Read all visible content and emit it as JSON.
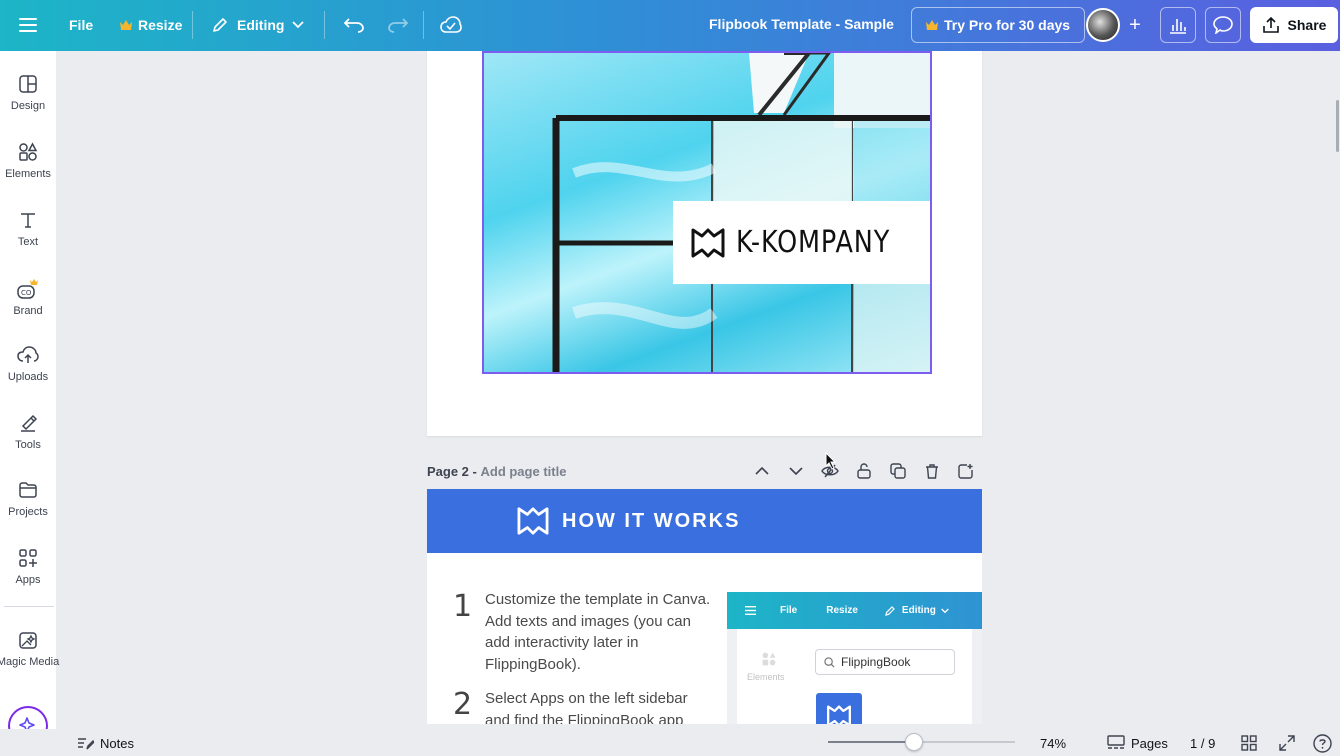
{
  "topbar": {
    "file_label": "File",
    "resize_label": "Resize",
    "editing_label": "Editing",
    "document_title": "Flipbook Template - Sample",
    "try_pro_label": "Try Pro for 30 days",
    "share_label": "Share"
  },
  "sidebar": {
    "items": [
      {
        "label": "Design",
        "icon": "design-icon"
      },
      {
        "label": "Elements",
        "icon": "elements-icon"
      },
      {
        "label": "Text",
        "icon": "text-icon"
      },
      {
        "label": "Brand",
        "icon": "brand-icon"
      },
      {
        "label": "Uploads",
        "icon": "uploads-icon"
      },
      {
        "label": "Tools",
        "icon": "tools-icon"
      },
      {
        "label": "Projects",
        "icon": "projects-icon"
      },
      {
        "label": "Apps",
        "icon": "apps-icon"
      },
      {
        "label": "Magic Media",
        "icon": "magic-media-icon"
      }
    ]
  },
  "page1": {
    "logo_text": "K-KOMPANY"
  },
  "page2": {
    "label": "Page 2 -",
    "title_placeholder": "Add page title",
    "banner_title": "HOW IT WORKS",
    "steps": [
      {
        "number": "1",
        "text": "Customize the template in Canva. Add texts and images (you can add interactivity later in FlippingBook)."
      },
      {
        "number": "2",
        "text": "Select Apps on the left sidebar and find the FlippingBook app"
      }
    ],
    "mock": {
      "file": "File",
      "resize": "Resize",
      "editing": "Editing",
      "search_value": "FlippingBook",
      "elements_label": "Elements"
    }
  },
  "bottombar": {
    "notes_label": "Notes",
    "zoom_level": "74%",
    "zoom_fraction": 0.46,
    "pages_label": "Pages",
    "page_counter": "1 / 9"
  },
  "colors": {
    "topbar_start": "#1db5c7",
    "topbar_end": "#5a5fe0",
    "banner_blue": "#3a6fdf",
    "selection_purple": "#7d5cf0",
    "crown_gold": "#f5b52e"
  }
}
